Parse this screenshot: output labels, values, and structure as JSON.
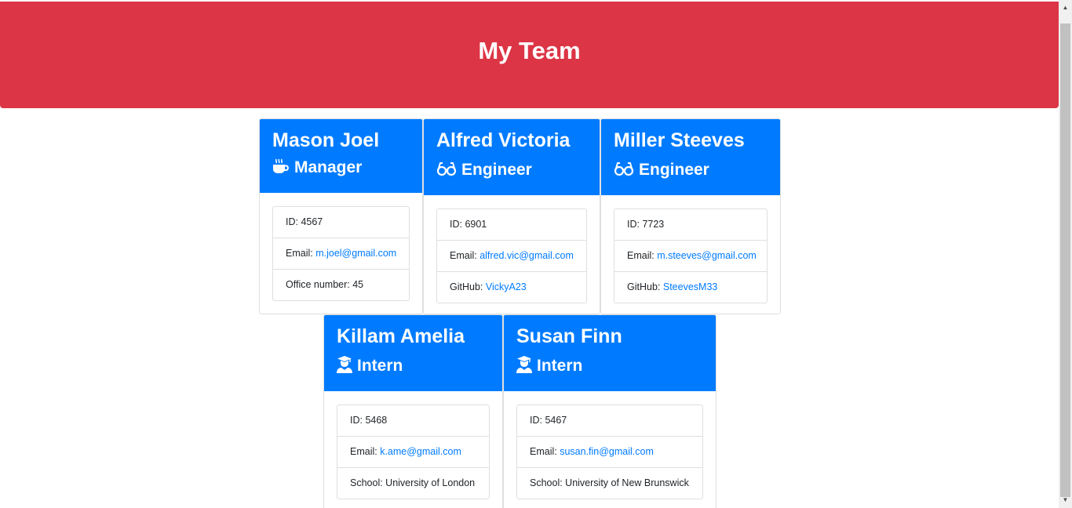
{
  "header": {
    "title": "My Team"
  },
  "employees": [
    {
      "name": "Mason Joel",
      "role": "Manager",
      "icon": "coffee-icon",
      "id_label": "ID: ",
      "id": "4567",
      "email_label": "Email: ",
      "email": "m.joel@gmail.com",
      "extra_label": "Office number: ",
      "extra": "45"
    },
    {
      "name": "Alfred Victoria",
      "role": "Engineer",
      "icon": "glasses-icon",
      "id_label": "ID: ",
      "id": "6901",
      "email_label": "Email: ",
      "email": "alfred.vic@gmail.com",
      "extra_label": "GitHub: ",
      "extra": "VickyA23"
    },
    {
      "name": "Miller Steeves",
      "role": "Engineer",
      "icon": "glasses-icon",
      "id_label": "ID: ",
      "id": "7723",
      "email_label": "Email: ",
      "email": "m.steeves@gmail.com",
      "extra_label": "GitHub: ",
      "extra": "SteevesM33"
    },
    {
      "name": "Killam Amelia",
      "role": "Intern",
      "icon": "graduate-icon",
      "id_label": "ID: ",
      "id": "5468",
      "email_label": "Email: ",
      "email": "k.ame@gmail.com",
      "extra_label": "School: ",
      "extra": "University of London"
    },
    {
      "name": "Susan Finn",
      "role": "Intern",
      "icon": "graduate-icon",
      "id_label": "ID: ",
      "id": "5467",
      "email_label": "Email: ",
      "email": "susan.fin@gmail.com",
      "extra_label": "School: ",
      "extra": "University of New Brunswick"
    }
  ],
  "colors": {
    "header_bg": "#dc3545",
    "card_header_bg": "#007bff",
    "link": "#007bff"
  }
}
